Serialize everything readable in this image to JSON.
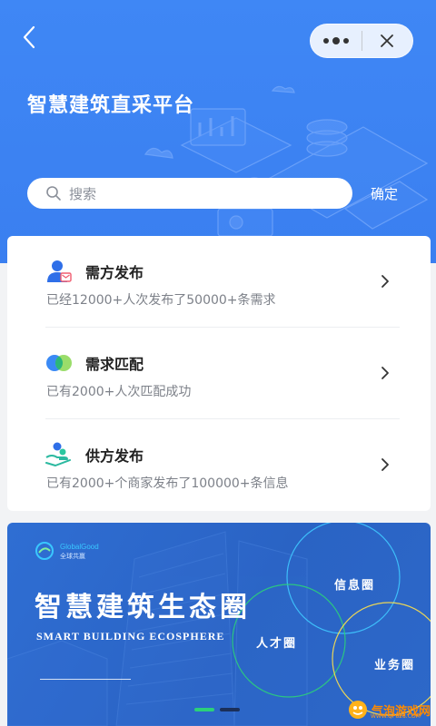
{
  "header": {
    "title": "智慧建筑直采平台",
    "search_placeholder": "搜索",
    "confirm_label": "确定"
  },
  "services": [
    {
      "icon": "demand-publish-icon",
      "title": "需方发布",
      "subtitle": "已经12000+人次发布了50000+条需求"
    },
    {
      "icon": "match-icon",
      "title": "需求匹配",
      "subtitle": "已有2000+人次匹配成功"
    },
    {
      "icon": "supply-publish-icon",
      "title": "供方发布",
      "subtitle": "已有2000+个商家发布了100000+条信息"
    }
  ],
  "banner": {
    "brand_name": "GlobalGood",
    "brand_cn": "全球共赢",
    "title": "智慧建筑生态圈",
    "subtitle": "SMART BUILDING ECOSPHERE",
    "tags": [
      "信息圈",
      "人才圈",
      "业务圈"
    ],
    "active_slide": 1,
    "slide_count": 2
  },
  "watermark": {
    "text": "气泡游戏网",
    "url": "WWW.QP828.COM"
  },
  "colors": {
    "header_blue": "#3f87f5",
    "accent_green": "#2bd07a",
    "banner_blue": "#2f6ed3"
  }
}
